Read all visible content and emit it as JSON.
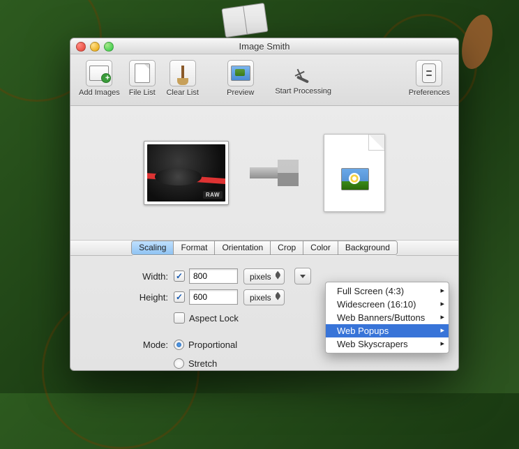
{
  "window": {
    "title": "Image Smith"
  },
  "toolbar": {
    "add_images": "Add Images",
    "file_list": "File List",
    "clear_list": "Clear List",
    "preview": "Preview",
    "start_processing": "Start Processing",
    "preferences": "Preferences"
  },
  "hero": {
    "source_badge": "RAW"
  },
  "tabs": {
    "items": [
      "Scaling",
      "Format",
      "Orientation",
      "Crop",
      "Color",
      "Background"
    ],
    "selected": "Scaling"
  },
  "scaling": {
    "width_label": "Width:",
    "width_enabled": true,
    "width_value": "800",
    "width_unit": "pixels",
    "height_label": "Height:",
    "height_enabled": true,
    "height_value": "600",
    "height_unit": "pixels",
    "aspect_lock_label": "Aspect Lock",
    "aspect_lock_checked": false,
    "mode_label": "Mode:",
    "mode_options": {
      "proportional": "Proportional",
      "stretch": "Stretch"
    },
    "mode_selected": "proportional"
  },
  "preset_menu": {
    "items": [
      "Full Screen (4:3)",
      "Widescreen (16:10)",
      "Web Banners/Buttons",
      "Web Popups",
      "Web Skyscrapers"
    ],
    "highlighted": "Web Popups"
  }
}
